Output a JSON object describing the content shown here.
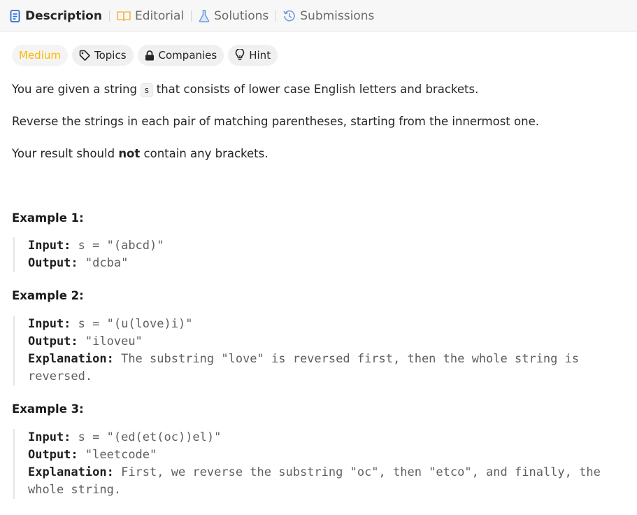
{
  "tabs": {
    "description": "Description",
    "editorial": "Editorial",
    "solutions": "Solutions",
    "submissions": "Submissions"
  },
  "tags": {
    "difficulty": "Medium",
    "topics": "Topics",
    "companies": "Companies",
    "hint": "Hint"
  },
  "colors": {
    "medium": "#ffb800",
    "description_icon": "#2c6cd6",
    "editorial_icon": "#f5b84a",
    "solutions_icon": "#6f9de0",
    "submissions_icon": "#6f9de0"
  },
  "description": {
    "p1_before": "You are given a string ",
    "p1_code": "s",
    "p1_after": " that consists of lower case English letters and brackets.",
    "p2": "Reverse the strings in each pair of matching parentheses, starting from the innermost one.",
    "p3_before": "Your result should ",
    "p3_bold": "not",
    "p3_after": " contain any brackets."
  },
  "examples": [
    {
      "title": "Example 1:",
      "input_label": "Input:",
      "input": "s = \"(abcd)\"",
      "output_label": "Output:",
      "output": "\"dcba\""
    },
    {
      "title": "Example 2:",
      "input_label": "Input:",
      "input": "s = \"(u(love)i)\"",
      "output_label": "Output:",
      "output": "\"iloveu\"",
      "explanation_label": "Explanation:",
      "explanation": "The substring \"love\" is reversed first, then the whole string is reversed."
    },
    {
      "title": "Example 3:",
      "input_label": "Input:",
      "input": "s = \"(ed(et(oc))el)\"",
      "output_label": "Output:",
      "output": "\"leetcode\"",
      "explanation_label": "Explanation:",
      "explanation": "First, we reverse the substring \"oc\", then \"etco\", and finally, the whole string."
    }
  ]
}
